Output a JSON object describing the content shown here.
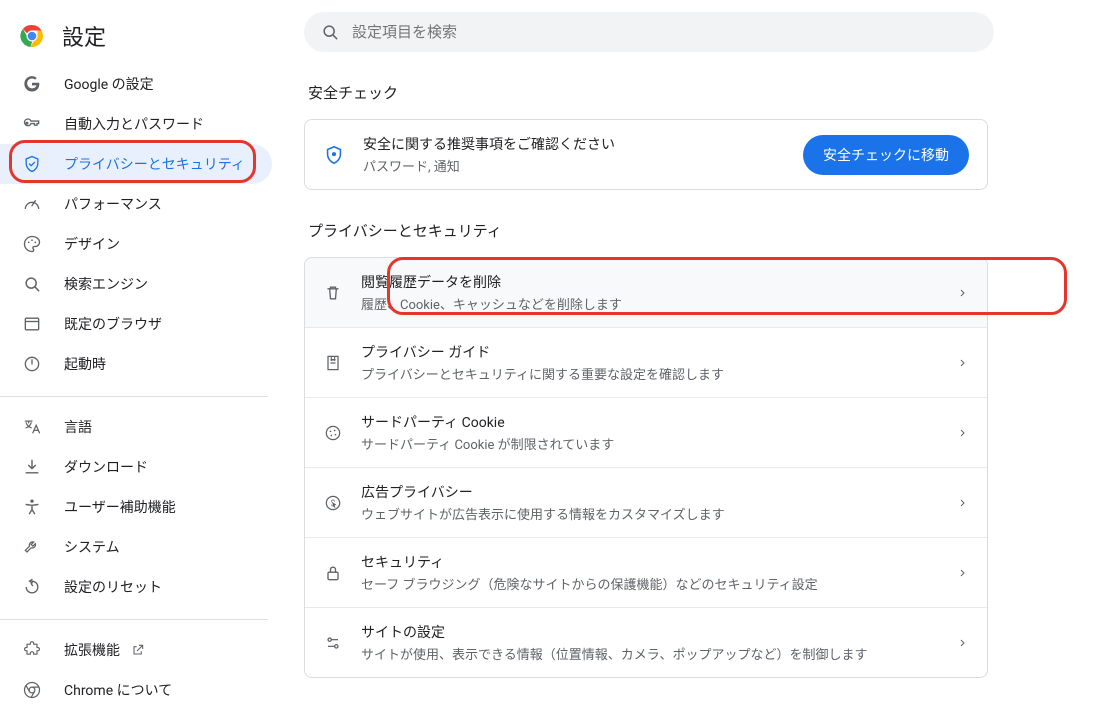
{
  "app_title": "設定",
  "search": {
    "placeholder": "設定項目を検索"
  },
  "sidebar": {
    "items": [
      {
        "id": "google",
        "label": "Google の設定",
        "icon": "google-g"
      },
      {
        "id": "autofill",
        "label": "自動入力とパスワード",
        "icon": "key"
      },
      {
        "id": "privacy",
        "label": "プライバシーとセキュリティ",
        "icon": "shield-check",
        "selected": true
      },
      {
        "id": "perf",
        "label": "パフォーマンス",
        "icon": "speed"
      },
      {
        "id": "design",
        "label": "デザイン",
        "icon": "palette"
      },
      {
        "id": "search",
        "label": "検索エンジン",
        "icon": "magnify"
      },
      {
        "id": "browser",
        "label": "既定のブラウザ",
        "icon": "browser"
      },
      {
        "id": "startup",
        "label": "起動時",
        "icon": "power"
      }
    ],
    "items2": [
      {
        "id": "lang",
        "label": "言語",
        "icon": "translate"
      },
      {
        "id": "download",
        "label": "ダウンロード",
        "icon": "download"
      },
      {
        "id": "a11y",
        "label": "ユーザー補助機能",
        "icon": "accessibility"
      },
      {
        "id": "system",
        "label": "システム",
        "icon": "tools"
      },
      {
        "id": "reset",
        "label": "設定のリセット",
        "icon": "reset"
      }
    ],
    "items3": [
      {
        "id": "ext",
        "label": "拡張機能",
        "icon": "extension",
        "external": true
      },
      {
        "id": "about",
        "label": "Chrome について",
        "icon": "chrome"
      }
    ]
  },
  "sections": {
    "safety": {
      "title": "安全チェック",
      "headline": "安全に関する推奨事項をご確認ください",
      "subline": "パスワード, 通知",
      "button": "安全チェックに移動"
    },
    "privacy": {
      "title": "プライバシーとセキュリティ",
      "rows": [
        {
          "id": "clear",
          "icon": "trash",
          "title": "閲覧履歴データを削除",
          "sub": "履歴、Cookie、キャッシュなどを削除します"
        },
        {
          "id": "guide",
          "icon": "guide",
          "title": "プライバシー ガイド",
          "sub": "プライバシーとセキュリティに関する重要な設定を確認します"
        },
        {
          "id": "cookies",
          "icon": "cookie",
          "title": "サードパーティ Cookie",
          "sub": "サードパーティ Cookie が制限されています"
        },
        {
          "id": "ads",
          "icon": "ads",
          "title": "広告プライバシー",
          "sub": "ウェブサイトが広告表示に使用する情報をカスタマイズします"
        },
        {
          "id": "security",
          "icon": "lock",
          "title": "セキュリティ",
          "sub": "セーフ ブラウジング（危険なサイトからの保護機能）などのセキュリティ設定"
        },
        {
          "id": "sites",
          "icon": "sliders",
          "title": "サイトの設定",
          "sub": "サイトが使用、表示できる情報（位置情報、カメラ、ポップアップなど）を制御します"
        }
      ]
    }
  }
}
